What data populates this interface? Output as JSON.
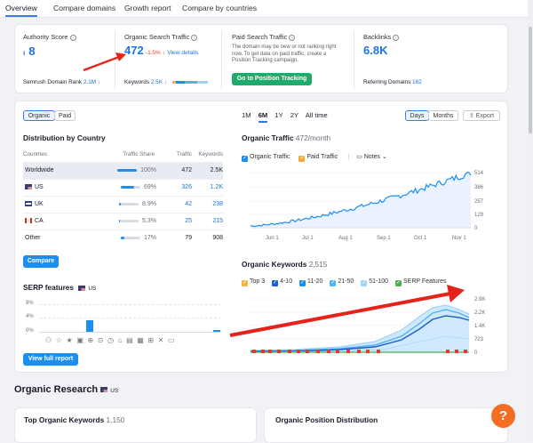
{
  "tabs": [
    "Overview",
    "Compare domains",
    "Growth report",
    "Compare by countries"
  ],
  "metrics": {
    "authority": {
      "title": "Authority Score",
      "value": "8"
    },
    "organic": {
      "title": "Organic Search Traffic",
      "value": "472",
      "change": "-1.5%",
      "link": "View details",
      "kw_label": "Keywords",
      "kw_value": "2.5K"
    },
    "paid": {
      "title": "Paid Search Traffic",
      "desc": "The domain may be new or not ranking right now. To get data on paid traffic, create a Position Tracking campaign.",
      "button": "Go to Position Tracking"
    },
    "backlinks": {
      "title": "Backlinks",
      "value": "6.8K",
      "ref_label": "Referring Domains",
      "ref_value": "162"
    },
    "rank_label": "Semrush Domain Rank",
    "rank_value": "2.1M"
  },
  "left": {
    "toggle_organic": "Organic",
    "toggle_paid": "Paid",
    "dist_title": "Distribution by Country",
    "cols": [
      "Countries",
      "Traffic Share",
      "Traffic",
      "Keywords"
    ],
    "rows": [
      {
        "country": "Worldwide",
        "share": "100%",
        "share_val": 1.0,
        "traffic": "472",
        "keywords": "2.5K"
      },
      {
        "country": "US",
        "share": "69%",
        "share_val": 0.69,
        "traffic": "326",
        "keywords": "1.2K"
      },
      {
        "country": "UK",
        "share": "8.9%",
        "share_val": 0.089,
        "traffic": "42",
        "keywords": "238"
      },
      {
        "country": "CA",
        "share": "5.3%",
        "share_val": 0.053,
        "traffic": "25",
        "keywords": "215"
      },
      {
        "country": "Other",
        "share": "17%",
        "share_val": 0.17,
        "traffic": "79",
        "keywords": "908"
      }
    ],
    "compare_btn": "Compare",
    "serp_title": "SERP features",
    "serp_country": "US",
    "serp_y": [
      "9%",
      "4%",
      "0%"
    ],
    "full_report_btn": "View full report"
  },
  "right": {
    "periods": [
      "1M",
      "6M",
      "1Y",
      "2Y",
      "All time"
    ],
    "active_period": "6M",
    "days": "Days",
    "months": "Months",
    "export": "Export",
    "traffic_title": "Organic Traffic",
    "traffic_sub": "472/month",
    "legend_organic": "Organic Traffic",
    "legend_paid": "Paid Traffic",
    "notes": "Notes",
    "months_axis": [
      "Jun 1",
      "Jul 1",
      "Aug 1",
      "Sep 1",
      "Oct 1",
      "Nov 1"
    ],
    "traffic_y": [
      "514",
      "386",
      "257",
      "129",
      "0"
    ],
    "kw_title": "Organic Keywords",
    "kw_sub": "2,515",
    "kw_legend": [
      "Top 3",
      "4-10",
      "11-20",
      "21-50",
      "51-100",
      "SERP Features"
    ],
    "kw_y": [
      "2.9K",
      "2.2K",
      "1.4K",
      "723",
      "0"
    ]
  },
  "bottom": {
    "section": "Organic Research",
    "country": "US",
    "top_kw": "Top Organic Keywords",
    "top_kw_count": "1,150",
    "pos_dist": "Organic Position Distribution"
  },
  "colors": {
    "accent": "#1a73e8",
    "green": "#1fab6b",
    "red": "#e5392b",
    "help": "#f46d25"
  }
}
